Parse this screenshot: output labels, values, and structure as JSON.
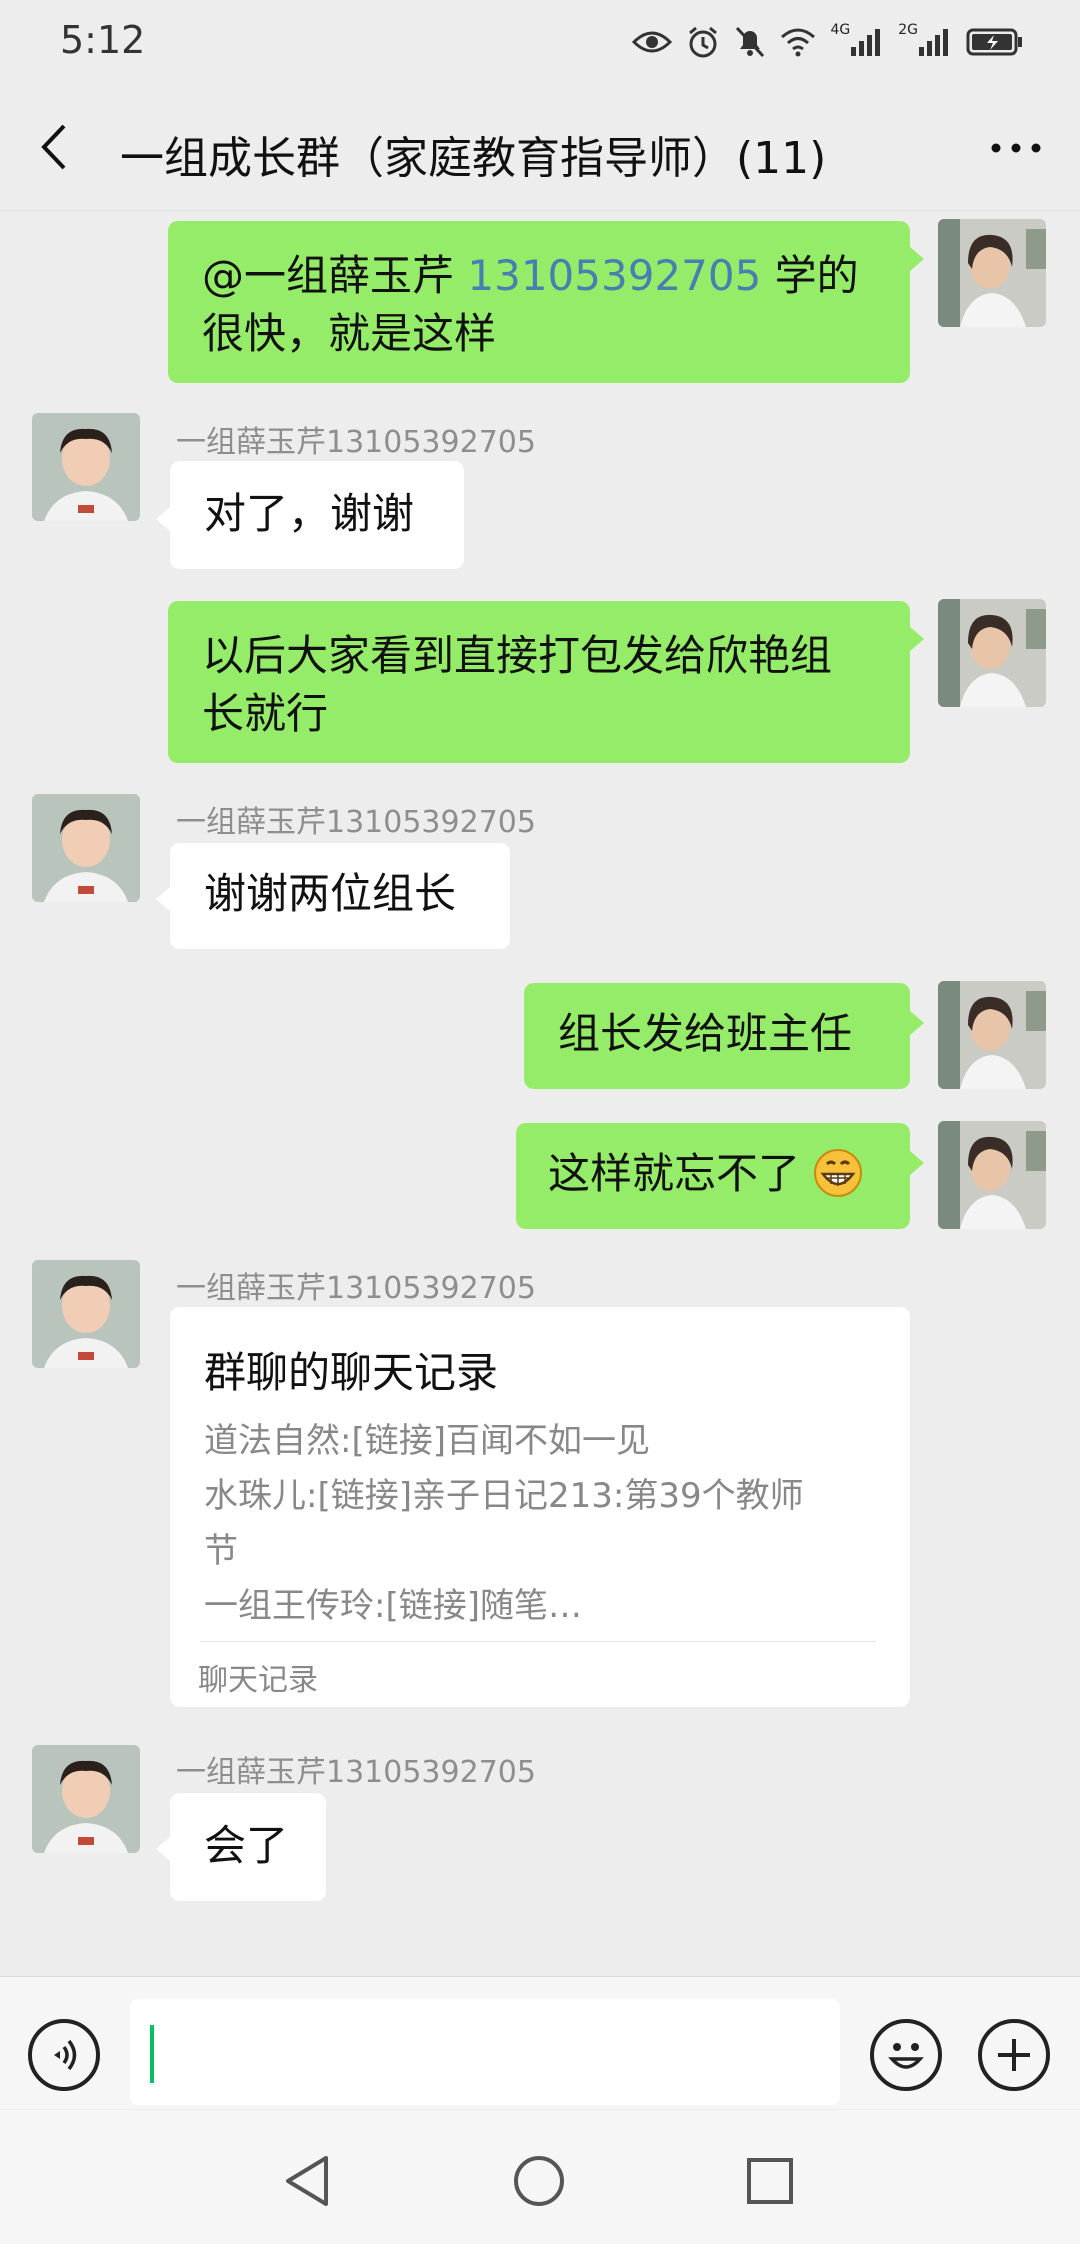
{
  "status_bar": {
    "time": "5:12",
    "network_1": "4G",
    "network_2": "2G",
    "icons": [
      "eye-icon",
      "alarm-icon",
      "mute-icon",
      "wifi-icon",
      "signal-icon",
      "signal-icon",
      "battery-charging-icon"
    ]
  },
  "header": {
    "title": "一组成长群（家庭教育指导师）(11)",
    "back_icon": "back-arrow-icon",
    "more_icon": "more-dots-icon"
  },
  "messages": [
    {
      "side": "right",
      "mention": "@一组薛玉芹",
      "mention_number": "13105392705",
      "line1_end": " 学的",
      "line2": "很快，就是这样"
    },
    {
      "side": "left",
      "sender": "一组薛玉芹13105392705",
      "text": "对了，谢谢"
    },
    {
      "side": "right",
      "line1": "以后大家看到直接打包发给欣艳组",
      "line2": "长就行"
    },
    {
      "side": "left",
      "sender": "一组薛玉芹13105392705",
      "text": "谢谢两位组长"
    },
    {
      "side": "right",
      "text": "组长发给班主任"
    },
    {
      "side": "right",
      "text": "这样就忘不了",
      "emoji": "grinning-emoji-icon"
    },
    {
      "side": "left",
      "sender": "一组薛玉芹13105392705",
      "card": {
        "title": "群聊的聊天记录",
        "lines": [
          "道法自然:[链接]百闻不如一见",
          "水珠儿:[链接]亲子日记213:第39个教师",
          "节",
          "一组王传玲:[链接]随笔…"
        ],
        "footer": "聊天记录"
      }
    },
    {
      "side": "left",
      "sender": "一组薛玉芹13105392705",
      "text": "会了"
    }
  ],
  "input_bar": {
    "voice_icon": "voice-icon",
    "emoji_icon": "emoji-icon",
    "add_icon": "plus-icon",
    "text_value": ""
  },
  "nav_bar": {
    "icons": [
      "nav-back-icon",
      "nav-home-icon",
      "nav-recents-icon"
    ]
  },
  "colors": {
    "sent_bubble": "#95ec69",
    "received_bubble": "#ffffff",
    "background": "#ededed",
    "cursor": "#07c160"
  }
}
